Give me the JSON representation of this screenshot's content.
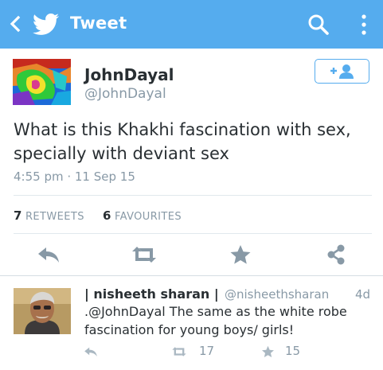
{
  "topbar": {
    "title": "Tweet"
  },
  "tweet": {
    "author_name": "JohnDayal",
    "author_handle": "@JohnDayal",
    "text": "What is this Khakhi fascination with sex, specially with deviant sex",
    "timestamp": "4:55 pm · 11 Sep 15",
    "retweet_count": "7",
    "retweet_label": "RETWEETS",
    "favourite_count": "6",
    "favourite_label": "FAVOURITES"
  },
  "reply": {
    "author_name": "| nisheeth sharan |",
    "author_handle": "@nisheethsharan",
    "time": "4d",
    "text": ".@JohnDayal The same as the white robe fascination for young boys/ girls!",
    "retweet_count": "17",
    "favourite_count": "15"
  },
  "colors": {
    "brand": "#55acee",
    "text": "#292f33",
    "muted": "#8899a6",
    "divider": "#e1e8ed"
  },
  "icons": {
    "back": "chevron-left-icon",
    "logo": "twitter-bird-icon",
    "search": "search-icon",
    "more": "more-vertical-icon",
    "follow": "follow-user-icon",
    "reply": "reply-icon",
    "retweet": "retweet-icon",
    "favourite": "star-icon",
    "share": "share-icon"
  }
}
